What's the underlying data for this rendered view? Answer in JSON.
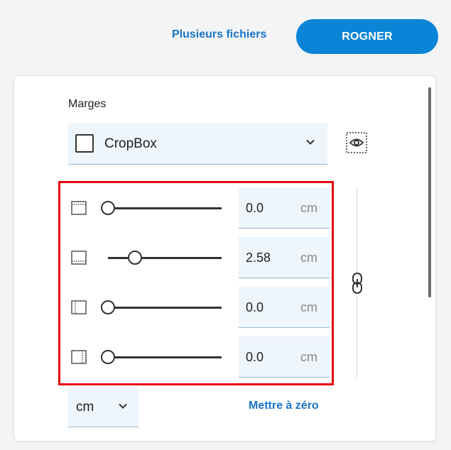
{
  "header": {
    "multiple_files_label": "Plusieurs fichiers",
    "crop_button_label": "ROGNER"
  },
  "margins": {
    "label": "Marges",
    "box_select": {
      "value": "CropBox",
      "icon": "chevron-down-icon"
    },
    "preview_icon": "eye-preview-icon",
    "link_icon": "chain-link-icon",
    "rows": [
      {
        "side": "top",
        "icon": "margin-top-icon",
        "value": "0.0",
        "unit": "cm",
        "slider_fraction": 0.0
      },
      {
        "side": "bottom",
        "icon": "margin-bottom-icon",
        "value": "2.58",
        "unit": "cm",
        "slider_fraction": 0.25
      },
      {
        "side": "left",
        "icon": "margin-left-icon",
        "value": "0.0",
        "unit": "cm",
        "slider_fraction": 0.0
      },
      {
        "side": "right",
        "icon": "margin-right-icon",
        "value": "0.0",
        "unit": "cm",
        "slider_fraction": 0.0
      }
    ],
    "unit_select": {
      "value": "cm"
    },
    "reset_label": "Mettre à zéro"
  },
  "colors": {
    "accent": "#0a84d6",
    "link": "#1a73c9",
    "highlight_frame": "#e3000f",
    "field_bg": "#eef5fb"
  }
}
